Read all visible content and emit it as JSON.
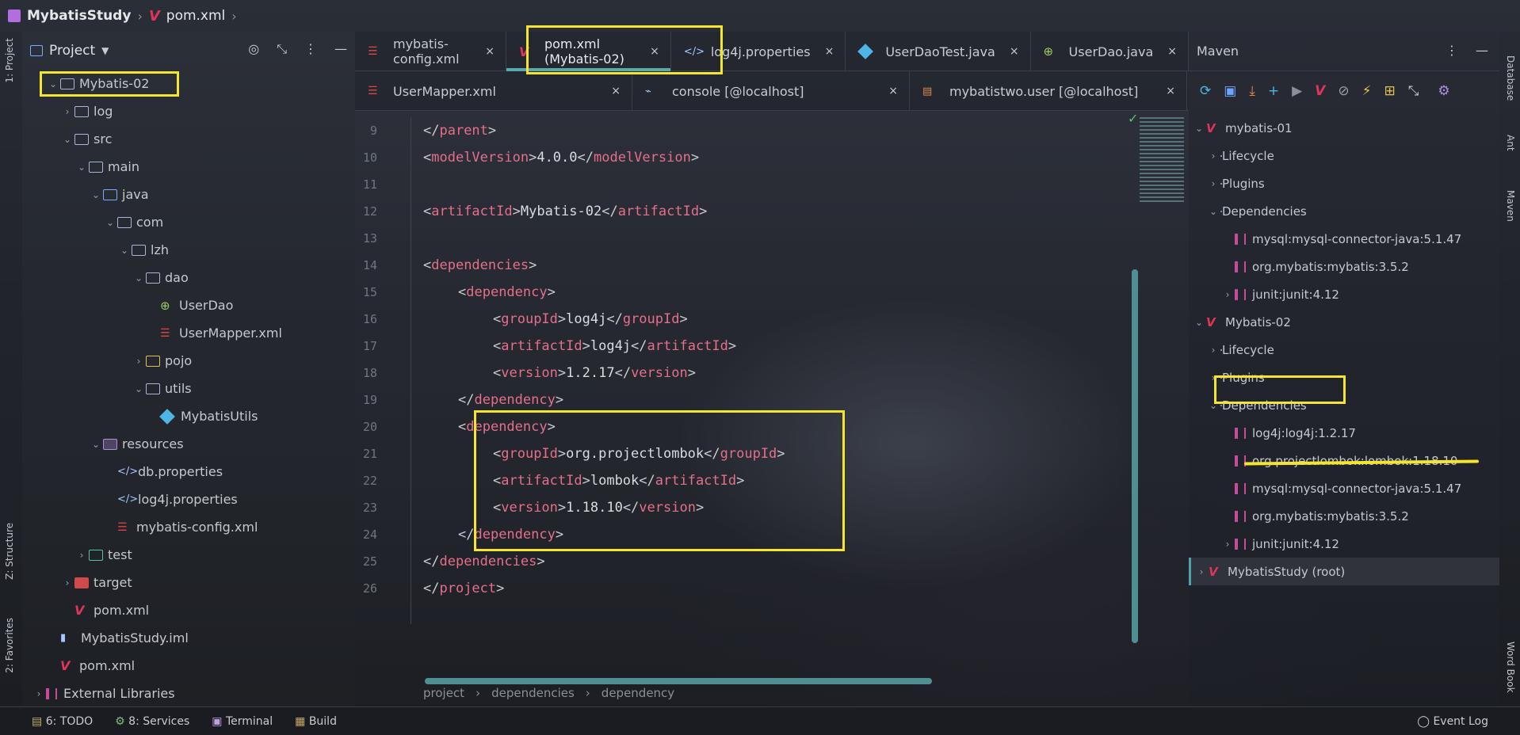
{
  "navbar": {
    "project": "MybatisStudy",
    "file": "pom.xml"
  },
  "left_strip": {
    "project_tab": "1: Project",
    "structure_tab": "Z: Structure",
    "favorites_tab": "2: Favorites"
  },
  "right_strip": {
    "database_tab": "Database",
    "ant_tab": "Ant",
    "maven_tab": "Maven",
    "wordbook_tab": "Word Book"
  },
  "project_panel": {
    "title": "Project",
    "tree": [
      {
        "label": "Mybatis-02",
        "depth": 0,
        "arrow": "v",
        "icon": "folder"
      },
      {
        "label": "log",
        "depth": 1,
        "arrow": ">",
        "icon": "folder"
      },
      {
        "label": "src",
        "depth": 1,
        "arrow": "v",
        "icon": "folder"
      },
      {
        "label": "main",
        "depth": 2,
        "arrow": "v",
        "icon": "folder"
      },
      {
        "label": "java",
        "depth": 3,
        "arrow": "v",
        "icon": "folder-blue"
      },
      {
        "label": "com",
        "depth": 4,
        "arrow": "v",
        "icon": "folder"
      },
      {
        "label": "lzh",
        "depth": 5,
        "arrow": "v",
        "icon": "folder"
      },
      {
        "label": "dao",
        "depth": 6,
        "arrow": "v",
        "icon": "folder"
      },
      {
        "label": "UserDao",
        "depth": 7,
        "arrow": "",
        "icon": "interface"
      },
      {
        "label": "UserMapper.xml",
        "depth": 7,
        "arrow": "",
        "icon": "xml"
      },
      {
        "label": "pojo",
        "depth": 6,
        "arrow": ">",
        "icon": "folder-yellow"
      },
      {
        "label": "utils",
        "depth": 6,
        "arrow": "v",
        "icon": "folder"
      },
      {
        "label": "MybatisUtils",
        "depth": 7,
        "arrow": "",
        "icon": "java"
      },
      {
        "label": "resources",
        "depth": 3,
        "arrow": "v",
        "icon": "folder-purple"
      },
      {
        "label": "db.properties",
        "depth": 4,
        "arrow": "",
        "icon": "prop"
      },
      {
        "label": "log4j.properties",
        "depth": 4,
        "arrow": "",
        "icon": "prop"
      },
      {
        "label": "mybatis-config.xml",
        "depth": 4,
        "arrow": "",
        "icon": "xml"
      },
      {
        "label": "test",
        "depth": 2,
        "arrow": ">",
        "icon": "folder-green"
      },
      {
        "label": "target",
        "depth": 1,
        "arrow": ">",
        "icon": "folder-red"
      },
      {
        "label": "pom.xml",
        "depth": 1,
        "arrow": "",
        "icon": "maven"
      },
      {
        "label": "MybatisStudy.iml",
        "depth": 0,
        "arrow": "",
        "icon": "iml"
      },
      {
        "label": "pom.xml",
        "depth": 0,
        "arrow": "",
        "icon": "maven"
      },
      {
        "label": "External Libraries",
        "depth": -1,
        "arrow": ">",
        "icon": "lib"
      }
    ]
  },
  "editor": {
    "tabs_row1": [
      {
        "label": "mybatis-config.xml",
        "icon": "xml"
      },
      {
        "label": "pom.xml (Mybatis-02)",
        "icon": "maven",
        "active": true
      },
      {
        "label": "log4j.properties",
        "icon": "prop"
      },
      {
        "label": "UserDaoTest.java",
        "icon": "java"
      },
      {
        "label": "UserDao.java",
        "icon": "interface"
      }
    ],
    "tabs_row2": [
      {
        "label": "UserMapper.xml",
        "icon": "xml"
      },
      {
        "label": "console [@localhost]",
        "icon": "console"
      },
      {
        "label": "mybatistwo.user [@localhost]",
        "icon": "db"
      }
    ],
    "lines": [
      {
        "n": "9",
        "indent": 1,
        "parts": [
          [
            "brk",
            "</"
          ],
          [
            "tag",
            "parent"
          ],
          [
            "brk",
            ">"
          ]
        ]
      },
      {
        "n": "10",
        "indent": 1,
        "parts": [
          [
            "brk",
            "<"
          ],
          [
            "tag",
            "modelVersion"
          ],
          [
            "brk",
            ">"
          ],
          [
            "text",
            "4.0.0"
          ],
          [
            "brk",
            "</"
          ],
          [
            "tag",
            "modelVersion"
          ],
          [
            "brk",
            ">"
          ]
        ]
      },
      {
        "n": "11",
        "indent": 0,
        "parts": []
      },
      {
        "n": "12",
        "indent": 1,
        "parts": [
          [
            "brk",
            "<"
          ],
          [
            "tag",
            "artifactId"
          ],
          [
            "brk",
            ">"
          ],
          [
            "text",
            "Mybatis-02"
          ],
          [
            "brk",
            "</"
          ],
          [
            "tag",
            "artifactId"
          ],
          [
            "brk",
            ">"
          ]
        ]
      },
      {
        "n": "13",
        "indent": 0,
        "parts": []
      },
      {
        "n": "14",
        "indent": 1,
        "parts": [
          [
            "brk",
            "<"
          ],
          [
            "tag",
            "dependencies"
          ],
          [
            "brk",
            ">"
          ]
        ]
      },
      {
        "n": "15",
        "indent": 2,
        "parts": [
          [
            "brk",
            "<"
          ],
          [
            "tag",
            "dependency"
          ],
          [
            "brk",
            ">"
          ]
        ]
      },
      {
        "n": "16",
        "indent": 3,
        "parts": [
          [
            "brk",
            "<"
          ],
          [
            "tag",
            "groupId"
          ],
          [
            "brk",
            ">"
          ],
          [
            "text",
            "log4j"
          ],
          [
            "brk",
            "</"
          ],
          [
            "tag",
            "groupId"
          ],
          [
            "brk",
            ">"
          ]
        ]
      },
      {
        "n": "17",
        "indent": 3,
        "parts": [
          [
            "brk",
            "<"
          ],
          [
            "tag",
            "artifactId"
          ],
          [
            "brk",
            ">"
          ],
          [
            "text",
            "log4j"
          ],
          [
            "brk",
            "</"
          ],
          [
            "tag",
            "artifactId"
          ],
          [
            "brk",
            ">"
          ]
        ]
      },
      {
        "n": "18",
        "indent": 3,
        "parts": [
          [
            "brk",
            "<"
          ],
          [
            "tag",
            "version"
          ],
          [
            "brk",
            ">"
          ],
          [
            "text",
            "1.2.17"
          ],
          [
            "brk",
            "</"
          ],
          [
            "tag",
            "version"
          ],
          [
            "brk",
            ">"
          ]
        ]
      },
      {
        "n": "19",
        "indent": 2,
        "parts": [
          [
            "brk",
            "</"
          ],
          [
            "tag",
            "dependency"
          ],
          [
            "brk",
            ">"
          ]
        ]
      },
      {
        "n": "20",
        "indent": 2,
        "parts": [
          [
            "brk",
            "<"
          ],
          [
            "tag",
            "dependency"
          ],
          [
            "brk",
            ">"
          ]
        ]
      },
      {
        "n": "21",
        "indent": 3,
        "parts": [
          [
            "brk",
            "<"
          ],
          [
            "tag",
            "groupId"
          ],
          [
            "brk",
            ">"
          ],
          [
            "text",
            "org.projectlombok"
          ],
          [
            "brk",
            "</"
          ],
          [
            "tag",
            "groupId"
          ],
          [
            "brk",
            ">"
          ]
        ]
      },
      {
        "n": "22",
        "indent": 3,
        "parts": [
          [
            "brk",
            "<"
          ],
          [
            "tag",
            "artifactId"
          ],
          [
            "brk",
            ">"
          ],
          [
            "text",
            "lombok"
          ],
          [
            "brk",
            "</"
          ],
          [
            "tag",
            "artifactId"
          ],
          [
            "brk",
            ">"
          ]
        ]
      },
      {
        "n": "23",
        "indent": 3,
        "parts": [
          [
            "brk",
            "<"
          ],
          [
            "tag",
            "version"
          ],
          [
            "brk",
            ">"
          ],
          [
            "text",
            "1.18.10"
          ],
          [
            "brk",
            "</"
          ],
          [
            "tag",
            "version"
          ],
          [
            "brk",
            ">"
          ]
        ]
      },
      {
        "n": "24",
        "indent": 2,
        "parts": [
          [
            "brk",
            "</"
          ],
          [
            "tag",
            "dependency"
          ],
          [
            "brk",
            ">"
          ]
        ]
      },
      {
        "n": "25",
        "indent": 1,
        "parts": [
          [
            "brk",
            "</"
          ],
          [
            "tag",
            "dependencies"
          ],
          [
            "brk",
            ">"
          ]
        ]
      },
      {
        "n": "26",
        "indent": 0,
        "parts": [
          [
            "brk",
            "</"
          ],
          [
            "tag",
            "project"
          ],
          [
            "brk",
            ">"
          ]
        ]
      }
    ],
    "breadcrumb": [
      "project",
      "dependencies",
      "dependency"
    ]
  },
  "maven": {
    "title": "Maven",
    "tree": [
      {
        "label": "mybatis-01",
        "depth": 0,
        "arrow": "v",
        "icon": "maven"
      },
      {
        "label": "Lifecycle",
        "depth": 1,
        "arrow": ">",
        "icon": "folder"
      },
      {
        "label": "Plugins",
        "depth": 1,
        "arrow": ">",
        "icon": "folder"
      },
      {
        "label": "Dependencies",
        "depth": 1,
        "arrow": "v",
        "icon": "folder-blue"
      },
      {
        "label": "mysql:mysql-connector-java:5.1.47",
        "depth": 2,
        "arrow": "",
        "icon": "lib"
      },
      {
        "label": "org.mybatis:mybatis:3.5.2",
        "depth": 2,
        "arrow": "",
        "icon": "lib"
      },
      {
        "label": "junit:junit:4.12",
        "depth": 2,
        "arrow": ">",
        "icon": "lib"
      },
      {
        "label": "Mybatis-02",
        "depth": 0,
        "arrow": "v",
        "icon": "maven"
      },
      {
        "label": "Lifecycle",
        "depth": 1,
        "arrow": ">",
        "icon": "folder"
      },
      {
        "label": "Plugins",
        "depth": 1,
        "arrow": ">",
        "icon": "folder"
      },
      {
        "label": "Dependencies",
        "depth": 1,
        "arrow": "v",
        "icon": "folder-blue"
      },
      {
        "label": "log4j:log4j:1.2.17",
        "depth": 2,
        "arrow": "",
        "icon": "lib"
      },
      {
        "label": "org.projectlombok:lombok:1.18.10",
        "depth": 2,
        "arrow": "",
        "icon": "lib"
      },
      {
        "label": "mysql:mysql-connector-java:5.1.47",
        "depth": 2,
        "arrow": "",
        "icon": "lib"
      },
      {
        "label": "org.mybatis:mybatis:3.5.2",
        "depth": 2,
        "arrow": "",
        "icon": "lib"
      },
      {
        "label": "junit:junit:4.12",
        "depth": 2,
        "arrow": ">",
        "icon": "lib"
      },
      {
        "label": "MybatisStudy (root)",
        "depth": 0,
        "arrow": ">",
        "icon": "maven",
        "selected": true
      }
    ]
  },
  "status": {
    "todo": "6: TODO",
    "services": "8: Services",
    "terminal": "Terminal",
    "build": "Build",
    "event_log": "Event Log"
  },
  "colors": {
    "highlight": "#f5e52c",
    "tag": "#e56f8a",
    "accent": "#5aa9b0"
  }
}
